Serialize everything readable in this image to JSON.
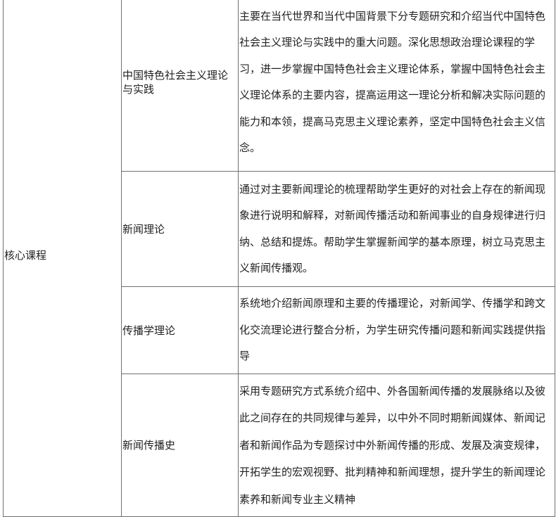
{
  "table": {
    "category": "核心课程",
    "courses": [
      {
        "name": "中国特色社会主义理论与实践",
        "description": "主要在当代世界和当代中国背景下分专题研究和介绍当代中国特色社会主义理论与实践中的重大问题。深化思想政治理论课程的学习，进一步掌握中国特色社会主义理论体系，掌握中国特色社会主义理论体系的主要内容，提高运用这一理论分析和解决实际问题的能力和本领，提高马克思主义理论素养，坚定中国特色社会主义信念。"
      },
      {
        "name": "新闻理论",
        "description": "通过对主要新闻理论的梳理帮助学生更好的对社会上存在的新闻现象进行说明和解释，对新闻传播活动和新闻事业的自身规律进行归纳、总结和提炼。帮助学生掌握新闻学的基本原理，树立马克思主义新闻传播观。"
      },
      {
        "name": "传播学理论",
        "description": "系统地介绍新闻原理和主要的传播理论，对新闻学、传播学和跨文化交流理论进行整合分析，为学生研究传播问题和新闻实践提供指导"
      },
      {
        "name": "新闻传播史",
        "description": "采用专题研究方式系统介绍中、外各国新闻传播的发展脉络以及彼此之间存在的共同规律与差异，以中外不同时期新闻媒体、新闻记者和新闻作品为专题探讨中外新闻传播的形成、发展及演变规律，开拓学生的宏观视野、批判精神和新闻理想，提升学生的新闻理论素养和新闻专业主义精神"
      }
    ]
  }
}
